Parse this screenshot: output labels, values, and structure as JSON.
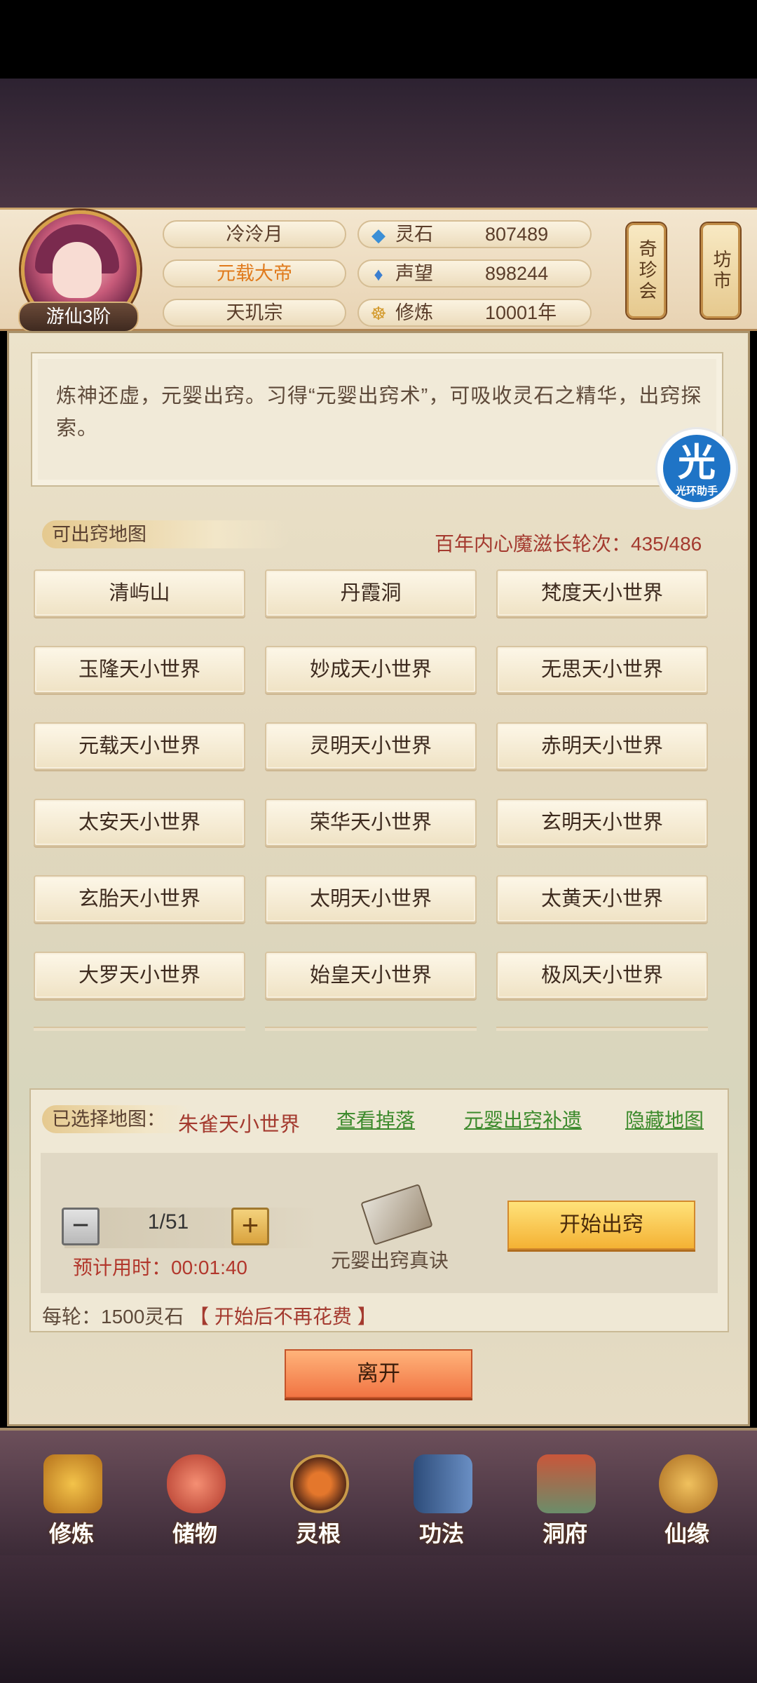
{
  "player": {
    "rank": "游仙3阶",
    "name": "冷泠月",
    "title": "元载大帝",
    "sect": "天玑宗"
  },
  "stats": [
    {
      "icon": "spirit-stone-icon",
      "label": "灵石",
      "value": "807489"
    },
    {
      "icon": "reputation-icon",
      "label": "声望",
      "value": "898244"
    },
    {
      "icon": "cultivation-icon",
      "label": "修炼",
      "value": "10001年"
    }
  ],
  "side_buttons": {
    "treasure_fair": "奇珍会",
    "market": "坊市"
  },
  "description": "炼神还虚，元婴出窍。习得“元婴出窍术”，可吸收灵石之精华，出窍探索。",
  "helper": {
    "glyph": "光",
    "caption": "光环助手"
  },
  "map_section": {
    "title": "可出窍地图",
    "counter": "百年内心魔滋长轮次：435/486"
  },
  "maps": [
    "清屿山",
    "丹霞洞",
    "梵度天小世界",
    "玉隆天小世界",
    "妙成天小世界",
    "无思天小世界",
    "元载天小世界",
    "灵明天小世界",
    "赤明天小世界",
    "太安天小世界",
    "荣华天小世界",
    "玄明天小世界",
    "玄胎天小世界",
    "太明天小世界",
    "太黄天小世界",
    "大罗天小世界",
    "始皇天小世界",
    "极风天小世界"
  ],
  "selection": {
    "label": "已选择地图：",
    "map": "朱雀天小世界",
    "links": [
      "查看掉落",
      "元婴出窍补遗",
      "隐藏地图"
    ],
    "rounds": "1/51",
    "eta": "预计用时：00:01:40",
    "book_label": "元婴出窍真诀",
    "start_label": "开始出窍",
    "cost_prefix": "每轮：1500灵石",
    "cost_note": "【 开始后不再花费 】"
  },
  "leave_label": "离开",
  "nav": [
    {
      "label": "修炼",
      "icon": "cultivate-icon"
    },
    {
      "label": "储物",
      "icon": "storage-bag-icon"
    },
    {
      "label": "灵根",
      "icon": "spirit-root-icon"
    },
    {
      "label": "功法",
      "icon": "technique-book-icon"
    },
    {
      "label": "洞府",
      "icon": "cave-dwelling-icon"
    },
    {
      "label": "仙缘",
      "icon": "immortal-fate-icon"
    }
  ]
}
